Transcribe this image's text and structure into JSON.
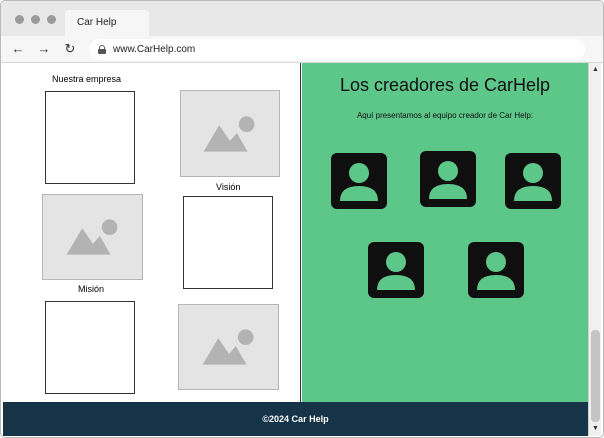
{
  "browser": {
    "tab_title": "Car Help",
    "url": "www.CarHelp.com",
    "icons": [
      "back-arrow-icon",
      "forward-arrow-icon",
      "reload-icon",
      "lock-icon"
    ]
  },
  "left": {
    "heading": "Nuestra empresa",
    "vision_label": "Visión",
    "mision_label": "Misión"
  },
  "right": {
    "title": "Los creadores de CarHelp",
    "subtitle": "Aquí presentamos al equipo creador de Car Help:",
    "avatar_icon": "person-avatar-icon",
    "avatar_count": 5
  },
  "footer": {
    "text": "©2024 Car Help"
  },
  "colors": {
    "right_bg": "#5dc789",
    "footer_bg": "#153448",
    "avatar": "#0f0f0f",
    "placeholder": "#e4e4e4"
  }
}
